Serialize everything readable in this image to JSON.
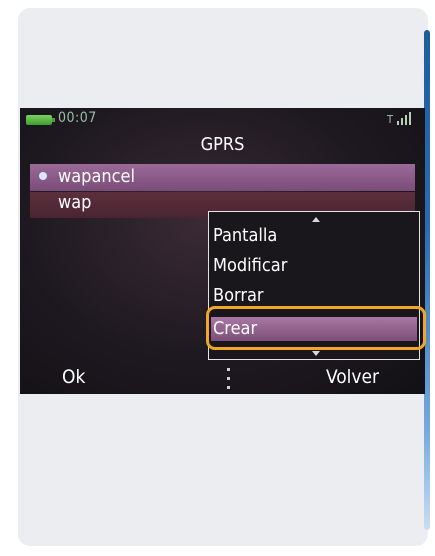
{
  "status": {
    "time": "00:07",
    "signal_indicator": "T"
  },
  "screen": {
    "title": "GPRS"
  },
  "profiles": [
    {
      "label": "wapancel",
      "selected": true
    },
    {
      "label": "wap",
      "selected": false
    }
  ],
  "context_menu": {
    "items": [
      {
        "label": "Pantalla"
      },
      {
        "label": "Modificar"
      },
      {
        "label": "Borrar"
      },
      {
        "label": "Crear",
        "selected": true
      }
    ]
  },
  "softkeys": {
    "left": "Ok",
    "right": "Volver"
  },
  "colors": {
    "highlight": "#f2a623",
    "selection": "#8c5b89",
    "accent_edge": "#2a6db4"
  },
  "icons": [
    "battery-icon",
    "signal-icon",
    "bullet-icon",
    "scroll-up-icon",
    "scroll-down-icon"
  ]
}
